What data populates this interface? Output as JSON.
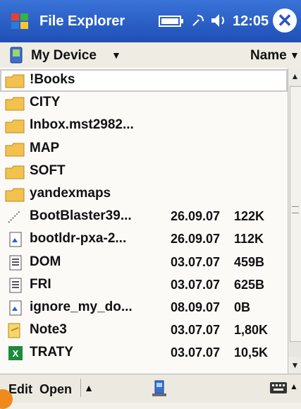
{
  "titlebar": {
    "app_title": "File Explorer",
    "time": "12:05",
    "close_label": "✕",
    "icons": [
      "windows-flag-icon",
      "battery-icon",
      "signal-icon",
      "volume-icon",
      "close-icon"
    ]
  },
  "location": {
    "device_label": "My Device",
    "sort_label": "Name"
  },
  "files": [
    {
      "name": "!Books",
      "date": "",
      "size": "",
      "type": "folder"
    },
    {
      "name": "CITY",
      "date": "",
      "size": "",
      "type": "folder"
    },
    {
      "name": "Inbox.mst2982...",
      "date": "",
      "size": "",
      "type": "folder"
    },
    {
      "name": "MAP",
      "date": "",
      "size": "",
      "type": "folder"
    },
    {
      "name": "SOFT",
      "date": "",
      "size": "",
      "type": "folder"
    },
    {
      "name": "yandexmaps",
      "date": "",
      "size": "",
      "type": "folder"
    },
    {
      "name": "BootBlaster39...",
      "date": "26.09.07",
      "size": "122K",
      "type": "exe"
    },
    {
      "name": "bootldr-pxa-2...",
      "date": "26.09.07",
      "size": "112K",
      "type": "file"
    },
    {
      "name": "DOM",
      "date": "03.07.07",
      "size": "459B",
      "type": "doc"
    },
    {
      "name": "FRI",
      "date": "03.07.07",
      "size": "625B",
      "type": "doc"
    },
    {
      "name": "ignore_my_do...",
      "date": "08.09.07",
      "size": "0B",
      "type": "file"
    },
    {
      "name": "Note3",
      "date": "03.07.07",
      "size": "1,80K",
      "type": "note"
    },
    {
      "name": "TRATY",
      "date": "03.07.07",
      "size": "10,5K",
      "type": "excel"
    }
  ],
  "bottombar": {
    "edit_label": "Edit",
    "open_label": "Open",
    "up_arrow": "▲",
    "kbd_arrow": "▲"
  },
  "colors": {
    "titlebar": "#2a5fcf",
    "folder": "#f2c14e",
    "accent": "#f08a1a"
  }
}
